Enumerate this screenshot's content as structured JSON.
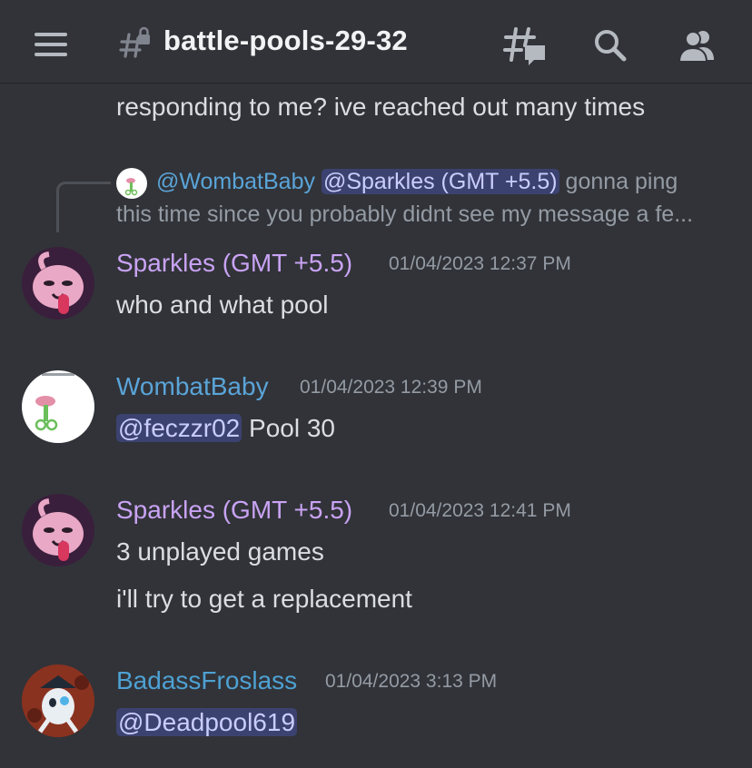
{
  "header": {
    "channel_name": "battle-pools-29-32",
    "menu_icon": "hamburger-menu-icon",
    "channel_icon": "locked-thread-channel-icon",
    "threads_icon": "threads-icon",
    "search_icon": "search-icon",
    "members_icon": "members-icon"
  },
  "colors": {
    "background": "#313338",
    "text": "#dbdee1",
    "timestamp": "#949ba4",
    "sparkles_name": "#c9a3f4",
    "wombat_name": "#5aa4d8",
    "froslass_name": "#4ea1d3",
    "mention_bg": "#3c4270",
    "mention_text": "#c9cdfb"
  },
  "messages": {
    "partial_text": "responding to me? ive reached out many times",
    "reply": {
      "author": "@WombatBaby",
      "mention": "@Sparkles (GMT +5.5)",
      "line1_rest": " gonna ping",
      "line2": "this time since you probably didnt see my message a fe..."
    },
    "m1": {
      "author": "Sparkles (GMT +5.5)",
      "timestamp": "01/04/2023 12:37 PM",
      "text": "who and what pool"
    },
    "m2": {
      "author": "WombatBaby",
      "timestamp": "01/04/2023 12:39 PM",
      "mention": "@feczzr02",
      "text": " Pool 30"
    },
    "m3": {
      "author": "Sparkles (GMT +5.5)",
      "timestamp": "01/04/2023 12:41 PM",
      "text1": "3 unplayed games",
      "text2": "i'll try to get a replacement"
    },
    "m4": {
      "author": "BadassFroslass",
      "timestamp": "01/04/2023 3:13 PM",
      "mention": "@Deadpool619"
    }
  }
}
